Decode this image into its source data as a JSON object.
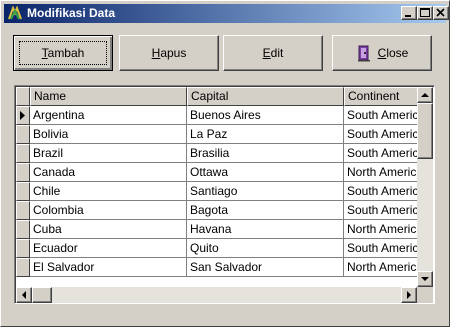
{
  "window": {
    "title": "Modifikasi Data"
  },
  "toolbar": {
    "tambah": {
      "pre": "",
      "u": "T",
      "post": "ambah"
    },
    "hapus": {
      "pre": "",
      "u": "H",
      "post": "apus"
    },
    "edit": {
      "pre": "",
      "u": "E",
      "post": "dit"
    },
    "close": {
      "pre": "",
      "u": "C",
      "post": "lose"
    }
  },
  "grid": {
    "columns": [
      "Name",
      "Capital",
      "Continent"
    ],
    "rows": [
      [
        "Argentina",
        "Buenos Aires",
        "South America"
      ],
      [
        "Bolivia",
        "La Paz",
        "South America"
      ],
      [
        "Brazil",
        "Brasilia",
        "South America"
      ],
      [
        "Canada",
        "Ottawa",
        "North America"
      ],
      [
        "Chile",
        "Santiago",
        "South America"
      ],
      [
        "Colombia",
        "Bagota",
        "South America"
      ],
      [
        "Cuba",
        "Havana",
        "North America"
      ],
      [
        "Ecuador",
        "Quito",
        "South America"
      ],
      [
        "El Salvador",
        "San Salvador",
        "North America"
      ]
    ]
  },
  "colors": {
    "titlebar_start": "#0a246a",
    "titlebar_end": "#a6caf0",
    "face": "#d4d0c8"
  }
}
